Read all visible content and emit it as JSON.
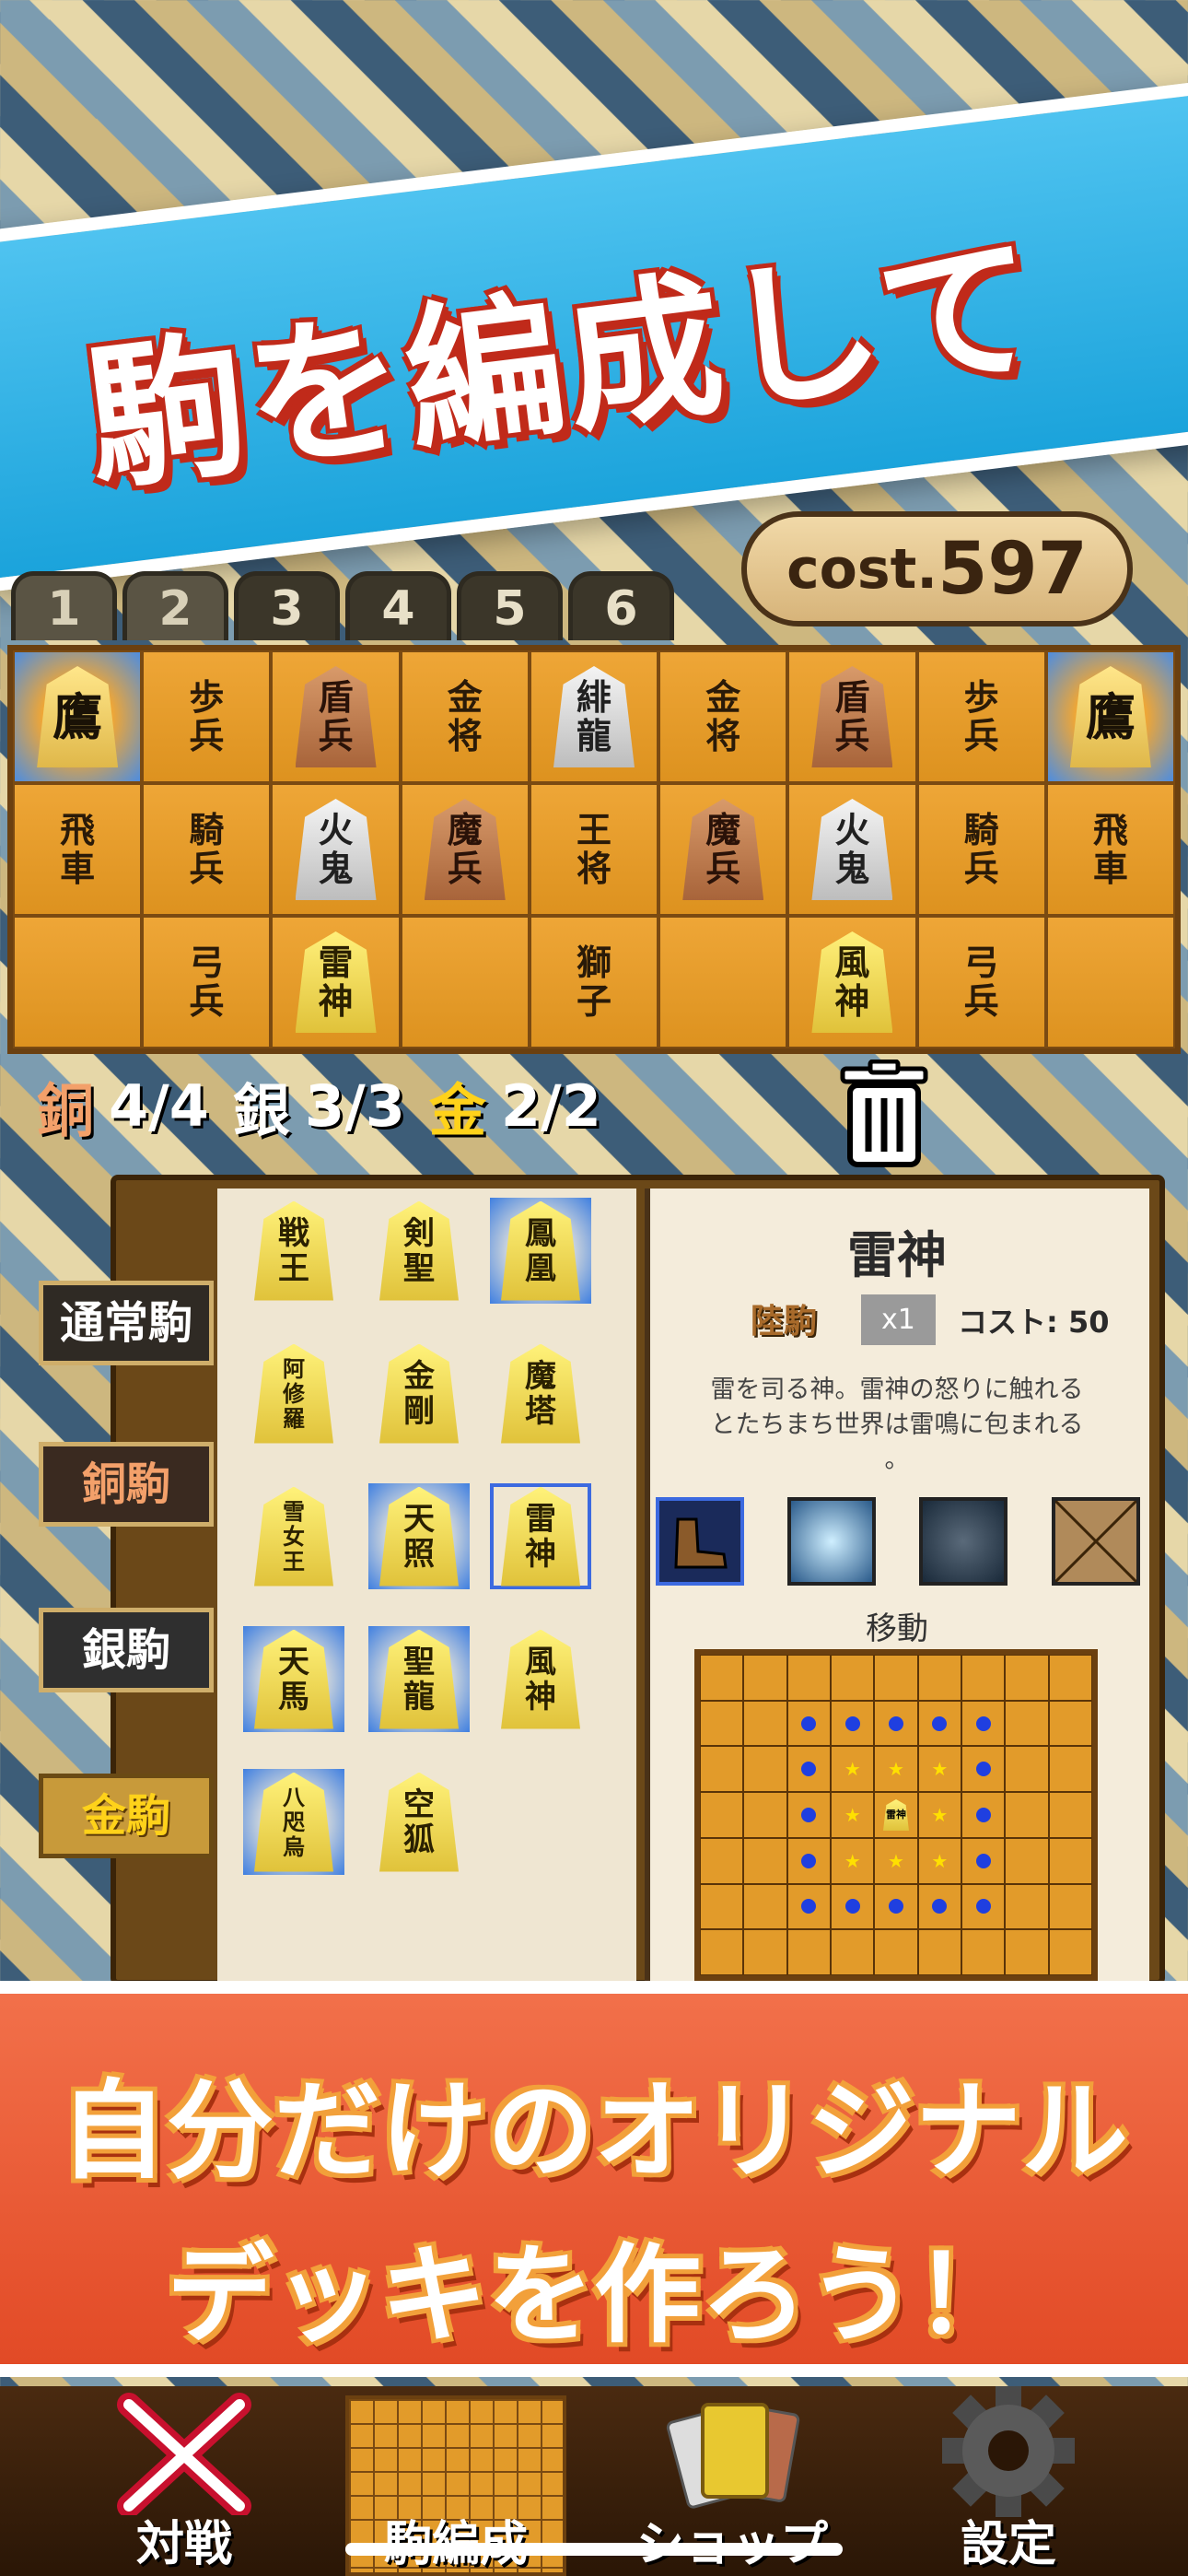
{
  "header": {
    "headline": "駒を編成して"
  },
  "cost": {
    "label": "cost.",
    "value": "597"
  },
  "deck_tabs": [
    "1",
    "2",
    "3",
    "4",
    "5",
    "6"
  ],
  "board": {
    "rows": [
      [
        {
          "t": "鷹",
          "k": "blue"
        },
        {
          "t": "歩兵",
          "k": "plain"
        },
        {
          "t": "盾兵",
          "k": "bronze"
        },
        {
          "t": "金将",
          "k": "plain"
        },
        {
          "t": "緋龍",
          "k": "silver"
        },
        {
          "t": "金将",
          "k": "plain"
        },
        {
          "t": "盾兵",
          "k": "bronze"
        },
        {
          "t": "歩兵",
          "k": "plain"
        },
        {
          "t": "鷹",
          "k": "blue"
        }
      ],
      [
        {
          "t": "飛車",
          "k": "plain"
        },
        {
          "t": "騎兵",
          "k": "plain"
        },
        {
          "t": "火鬼",
          "k": "silver"
        },
        {
          "t": "魔兵",
          "k": "bronze"
        },
        {
          "t": "王将",
          "k": "plain"
        },
        {
          "t": "魔兵",
          "k": "bronze"
        },
        {
          "t": "火鬼",
          "k": "silver"
        },
        {
          "t": "騎兵",
          "k": "plain"
        },
        {
          "t": "飛車",
          "k": "plain"
        }
      ],
      [
        {
          "t": "",
          "k": "none"
        },
        {
          "t": "弓兵",
          "k": "plain"
        },
        {
          "t": "雷神",
          "k": "gold"
        },
        {
          "t": "",
          "k": "none"
        },
        {
          "t": "獅子",
          "k": "plain"
        },
        {
          "t": "",
          "k": "none"
        },
        {
          "t": "風神",
          "k": "gold"
        },
        {
          "t": "弓兵",
          "k": "plain"
        },
        {
          "t": "",
          "k": "none"
        }
      ]
    ]
  },
  "counters": [
    {
      "kind": "銅",
      "value": "4/4"
    },
    {
      "kind": "銀",
      "value": "3/3"
    },
    {
      "kind": "金",
      "value": "2/2"
    }
  ],
  "categories": [
    "通常駒",
    "銅駒",
    "銀駒",
    "金駒"
  ],
  "piece_list": [
    {
      "t": "戦王",
      "bg": false,
      "sel": false
    },
    {
      "t": "剣聖",
      "bg": false,
      "sel": false
    },
    {
      "t": "鳳凰",
      "bg": true,
      "sel": false
    },
    {
      "t": "阿修羅",
      "bg": false,
      "sel": false,
      "small": true
    },
    {
      "t": "金剛",
      "bg": false,
      "sel": false
    },
    {
      "t": "魔塔",
      "bg": false,
      "sel": false
    },
    {
      "t": "雪女王",
      "bg": false,
      "sel": false,
      "small": true
    },
    {
      "t": "天照",
      "bg": true,
      "sel": false
    },
    {
      "t": "雷神",
      "bg": false,
      "sel": true
    },
    {
      "t": "天馬",
      "bg": true,
      "sel": false
    },
    {
      "t": "聖龍",
      "bg": true,
      "sel": false
    },
    {
      "t": "風神",
      "bg": false,
      "sel": false
    },
    {
      "t": "八咫烏",
      "bg": true,
      "sel": false,
      "small": true
    },
    {
      "t": "空狐",
      "bg": false,
      "sel": false
    }
  ],
  "detail": {
    "name": "雷神",
    "type": "陸駒",
    "badge": "x1",
    "cost": "コスト: 50",
    "desc1": "雷を司る神。雷神の怒りに触れる",
    "desc2": "とたちまち世界は雷鳴に包まれる",
    "desc3": "。",
    "move_label": "移動",
    "mini_piece": "雷神"
  },
  "footer_banner": {
    "line1": "自分だけのオリジナル",
    "line2": "デッキを作ろう！"
  },
  "tabbar": {
    "items": [
      {
        "label": "対戦",
        "icon": "crossed-swords-icon"
      },
      {
        "label": "駒編成",
        "icon": "board-icon"
      },
      {
        "label": "ショップ",
        "icon": "cards-icon"
      },
      {
        "label": "設定",
        "icon": "gear-icon"
      }
    ]
  },
  "colors": {
    "banner_blue": "#1ba3db",
    "banner_orange": "#e24a26",
    "board": "#e29b2a"
  }
}
